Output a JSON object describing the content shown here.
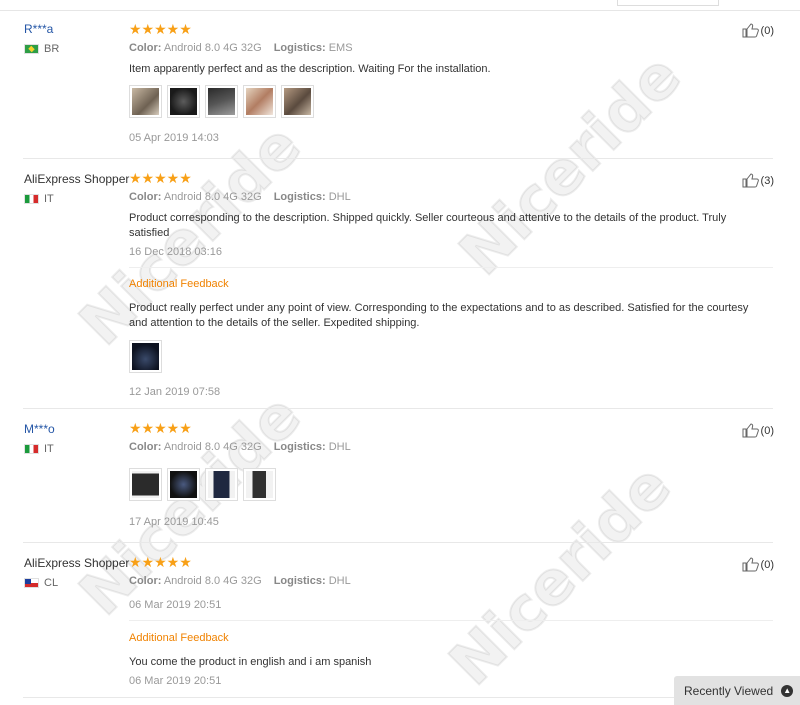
{
  "labels": {
    "color_key": "Color:",
    "logistics_key": "Logistics:",
    "additional_feedback": "Additional Feedback",
    "recently_viewed": "Recently Viewed"
  },
  "colors": {
    "stars": "#f8a017",
    "masked_user": "#2456a6",
    "additional_feedback": "#f08200"
  },
  "watermark": "Niceride",
  "reviews": [
    {
      "user": "R***a",
      "country": "BR",
      "flag_icon": "brazil-flag-icon",
      "rating": 5,
      "stars": "★★★★★",
      "color": "Android 8.0 4G 32G",
      "logistics": "EMS",
      "text": "Item apparently perfect and as the description. Waiting For the installation.",
      "images": 5,
      "date": "05 Apr 2019 14:03",
      "likes": "(0)"
    },
    {
      "user": "AliExpress Shopper",
      "country": "IT",
      "flag_icon": "italy-flag-icon",
      "rating": 5,
      "stars": "★★★★★",
      "color": "Android 8.0 4G 32G",
      "logistics": "DHL",
      "text": "Product corresponding to the description. Shipped quickly. Seller courteous and attentive to the details of the product. Truly satisfied",
      "date": "16 Dec 2018 03:16",
      "additional_text": "Product really perfect under any point of view. Corresponding to the expectations and to as described. Satisfied for the courtesy and attention to the details of the seller. Expedited shipping.",
      "additional_images": 1,
      "additional_date": "12 Jan 2019 07:58",
      "likes": "(3)"
    },
    {
      "user": "M***o",
      "country": "IT",
      "flag_icon": "italy-flag-icon",
      "rating": 5,
      "stars": "★★★★★",
      "color": "Android 8.0 4G 32G",
      "logistics": "DHL",
      "images": 4,
      "date": "17 Apr 2019 10:45",
      "likes": "(0)"
    },
    {
      "user": "AliExpress Shopper",
      "country": "CL",
      "flag_icon": "chile-flag-icon",
      "rating": 5,
      "stars": "★★★★★",
      "color": "Android 8.0 4G 32G",
      "logistics": "DHL",
      "date": "06 Mar 2019 20:51",
      "additional_text": "You come the product in english and i am spanish",
      "additional_date": "06 Mar 2019 20:51",
      "likes": "(0)"
    }
  ]
}
